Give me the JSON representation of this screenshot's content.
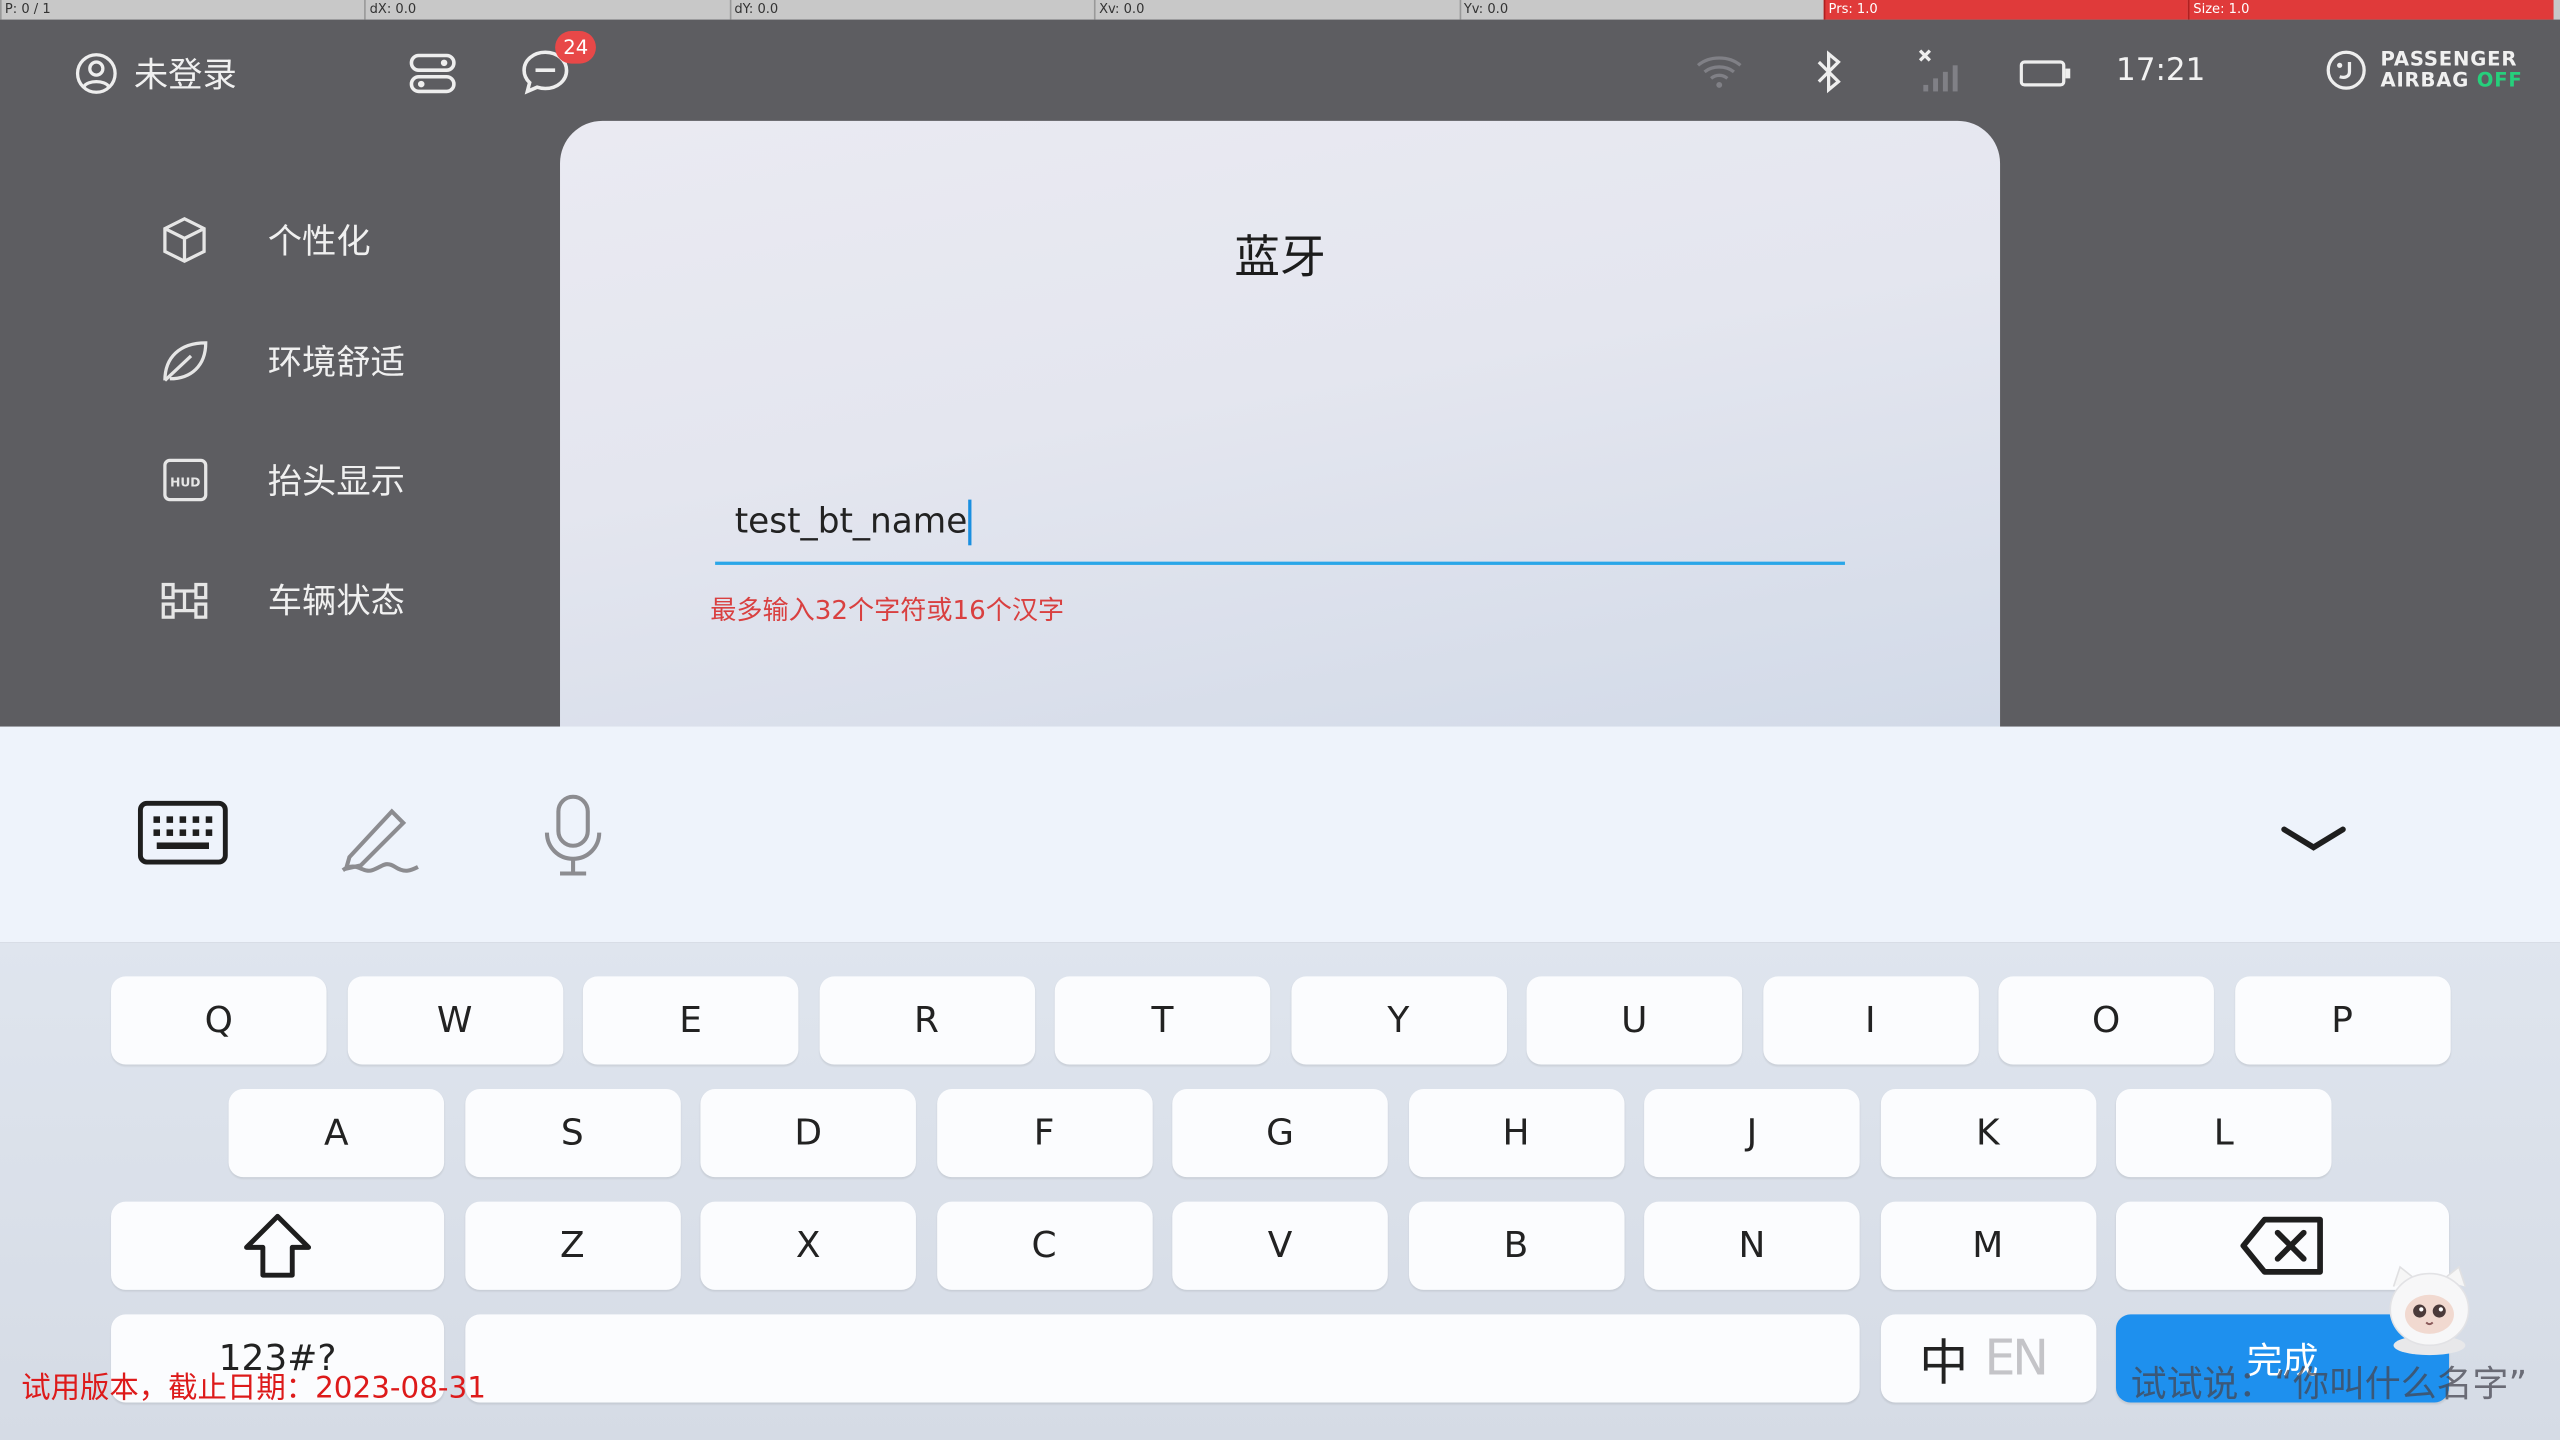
{
  "debug_bar": [
    "P: 0 / 1",
    "dX: 0.0",
    "dY: 0.0",
    "Xv: 0.0",
    "Yv: 0.0",
    "Prs: 1.0",
    "Size: 1.0"
  ],
  "status_bar": {
    "login_label": "未登录",
    "message_count": "24",
    "time": "17:21",
    "airbag_line1": "PASSENGER",
    "airbag_line2": "AIRBAG",
    "airbag_state": "OFF"
  },
  "sidebar": {
    "items": [
      {
        "label": "个性化",
        "icon": "cube-icon"
      },
      {
        "label": "环境舒适",
        "icon": "leaf-icon"
      },
      {
        "label": "抬头显示",
        "icon": "hud-icon"
      },
      {
        "label": "车辆状态",
        "icon": "vehicle-status-icon"
      }
    ]
  },
  "dialog": {
    "title": "蓝牙",
    "input_value": "test_bt_name",
    "hint": "最多输入32个字符或16个汉字"
  },
  "keyboard": {
    "row1": [
      "Q",
      "W",
      "E",
      "R",
      "T",
      "Y",
      "U",
      "I",
      "O",
      "P"
    ],
    "row2": [
      "A",
      "S",
      "D",
      "F",
      "G",
      "H",
      "J",
      "K",
      "L"
    ],
    "row3": [
      "Z",
      "X",
      "C",
      "V",
      "B",
      "N",
      "M"
    ],
    "symbols_label": "123#?",
    "lang_label": "中",
    "done_label": "完成"
  },
  "overlay": {
    "trial_text": "试用版本，截止日期：2023-08-31",
    "voice_hint": "试试说：“你叫什么名字”"
  },
  "colors": {
    "accent": "#1e90ee",
    "hint": "#d94040",
    "badge": "#e84848",
    "airbag_off": "#26d07c"
  }
}
